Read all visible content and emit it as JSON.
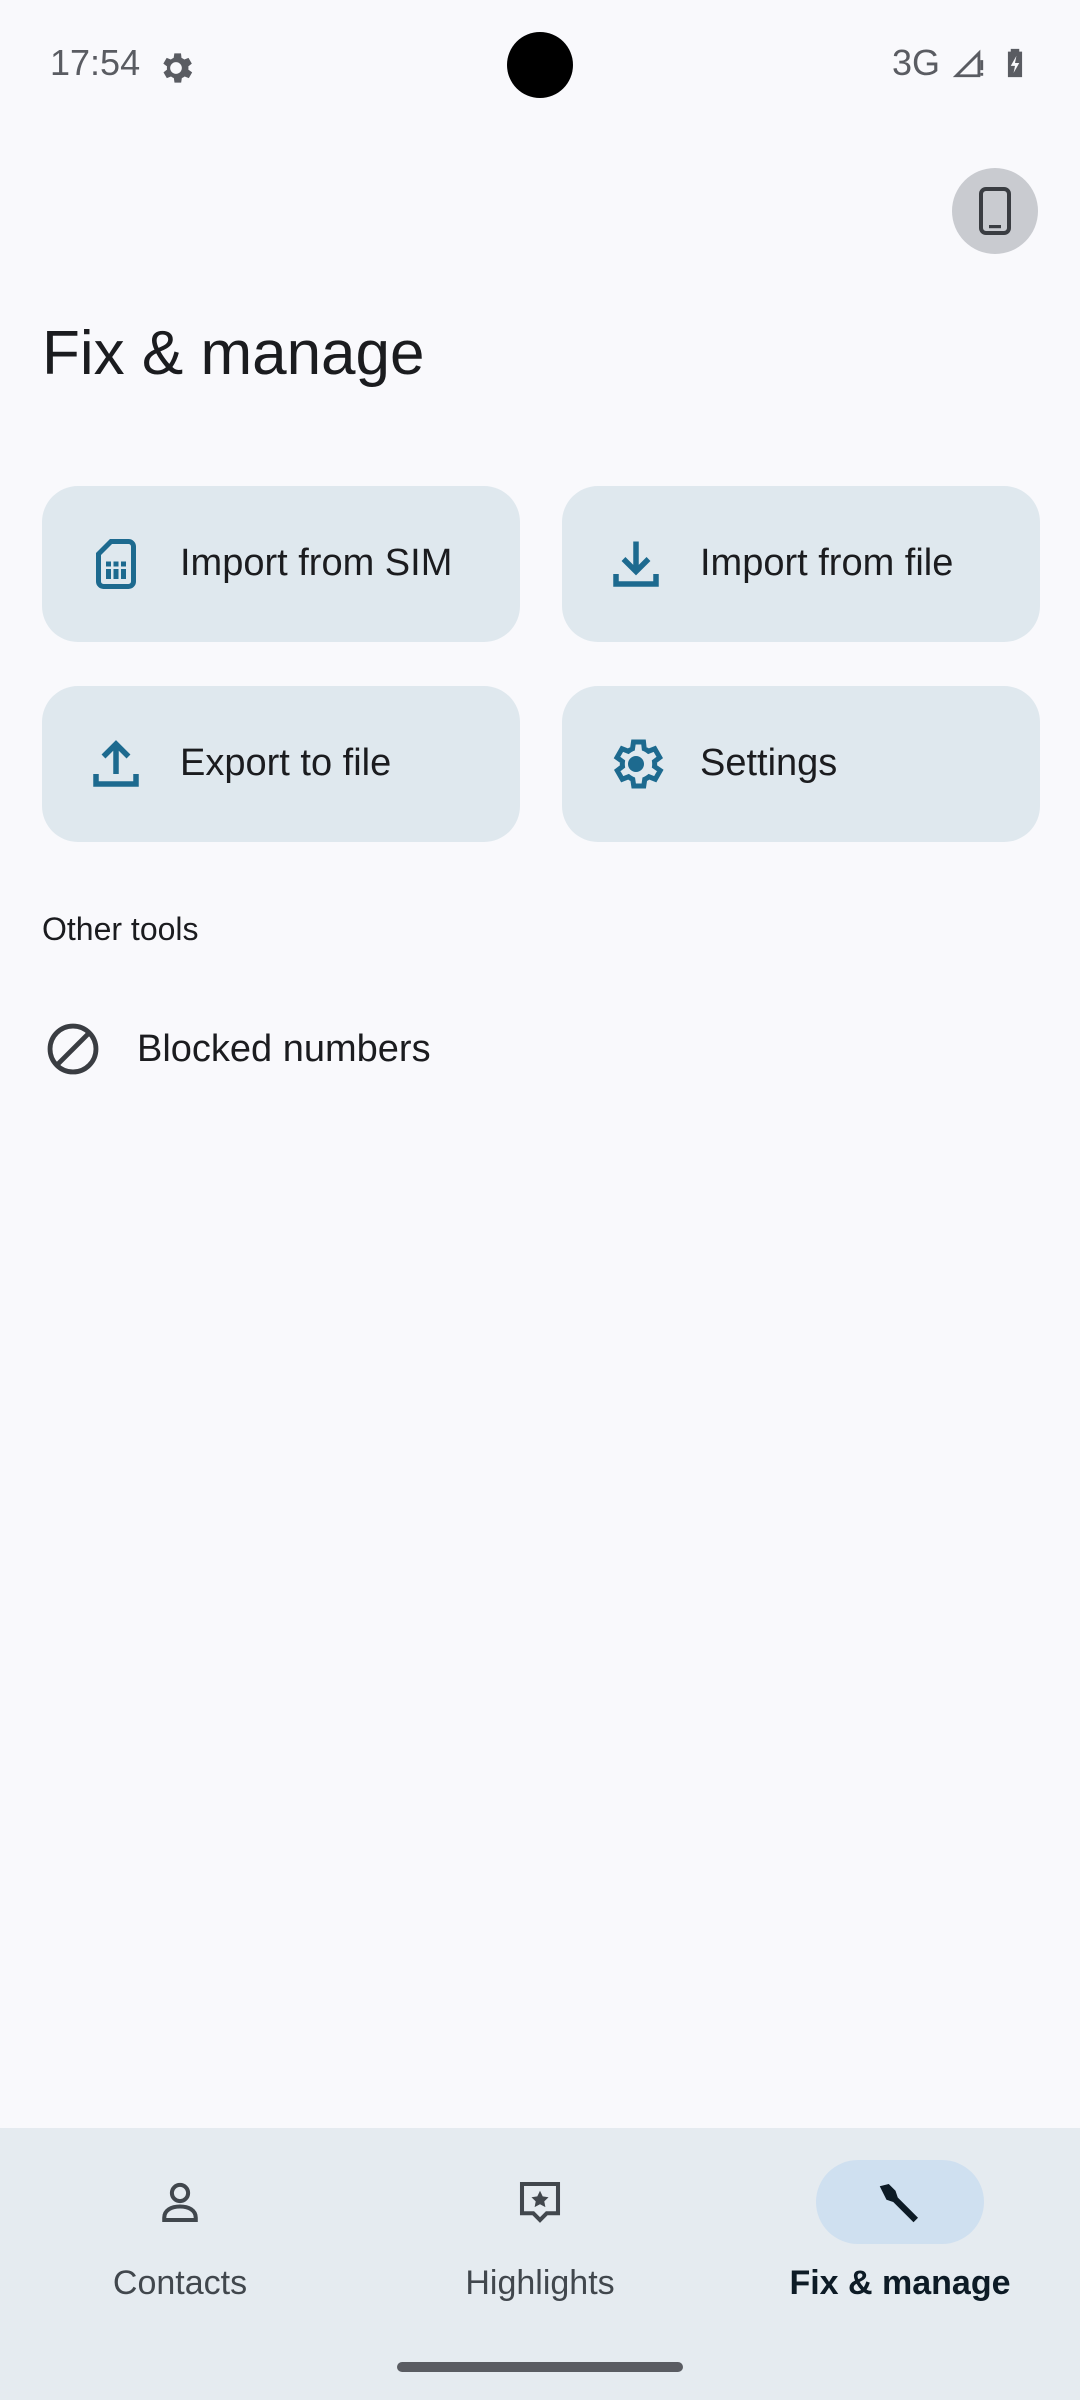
{
  "status_bar": {
    "time": "17:54",
    "network": "3G",
    "icons": [
      "settings-gear-icon",
      "signal-icon",
      "battery-icon"
    ]
  },
  "header": {
    "account_icon": "phone-account-icon"
  },
  "page": {
    "title": "Fix & manage"
  },
  "tools": [
    {
      "label": "Import from SIM",
      "icon": "sim-card-icon"
    },
    {
      "label": "Import from file",
      "icon": "download-icon"
    },
    {
      "label": "Export to file",
      "icon": "upload-icon"
    },
    {
      "label": "Settings",
      "icon": "settings-icon"
    }
  ],
  "other_tools": {
    "section_label": "Other tools",
    "items": [
      {
        "label": "Blocked numbers",
        "icon": "block-icon"
      }
    ]
  },
  "bottom_nav": {
    "items": [
      {
        "label": "Contacts",
        "icon": "contacts-icon",
        "active": false
      },
      {
        "label": "Highlights",
        "icon": "highlights-icon",
        "active": false
      },
      {
        "label": "Fix & manage",
        "icon": "wrench-icon",
        "active": true
      }
    ]
  },
  "colors": {
    "accent": "#1d6a8f",
    "card_bg": "#dfe8ee",
    "nav_bg": "#e5ebf0",
    "active_pill": "#cfe0f0"
  }
}
